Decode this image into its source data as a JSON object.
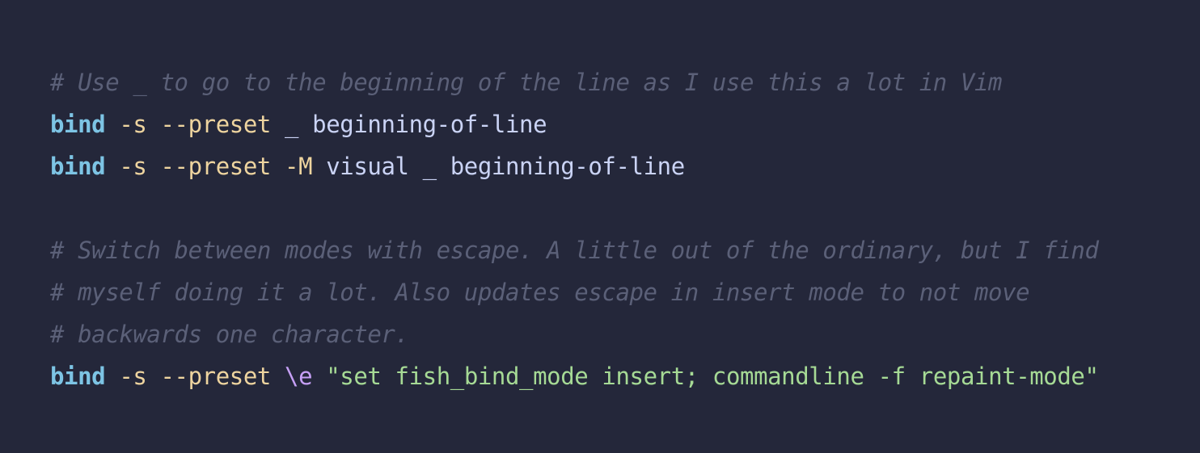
{
  "lines": [
    {
      "type": "comment",
      "text": "# Use _ to go to the beginning of the line as I use this a lot in Vim"
    },
    {
      "type": "code",
      "tokens": [
        {
          "cls": "kw",
          "text": "bind"
        },
        {
          "cls": "txt",
          "text": " "
        },
        {
          "cls": "opt",
          "text": "-s --preset"
        },
        {
          "cls": "txt",
          "text": " _ beginning-of-line"
        }
      ]
    },
    {
      "type": "code",
      "tokens": [
        {
          "cls": "kw",
          "text": "bind"
        },
        {
          "cls": "txt",
          "text": " "
        },
        {
          "cls": "opt",
          "text": "-s --preset -M"
        },
        {
          "cls": "txt",
          "text": " visual _ beginning-of-line"
        }
      ]
    },
    {
      "type": "blank"
    },
    {
      "type": "comment",
      "text": "# Switch between modes with escape. A little out of the ordinary, but I find"
    },
    {
      "type": "comment",
      "text": "# myself doing it a lot. Also updates escape in insert mode to not move"
    },
    {
      "type": "comment",
      "text": "# backwards one character."
    },
    {
      "type": "code",
      "tokens": [
        {
          "cls": "kw",
          "text": "bind"
        },
        {
          "cls": "txt",
          "text": " "
        },
        {
          "cls": "opt",
          "text": "-s --preset"
        },
        {
          "cls": "txt",
          "text": " "
        },
        {
          "cls": "esc",
          "text": "\\e"
        },
        {
          "cls": "txt",
          "text": " "
        },
        {
          "cls": "str",
          "text": "\"set fish_bind_mode insert; commandline -f repaint-mode\""
        }
      ]
    }
  ]
}
